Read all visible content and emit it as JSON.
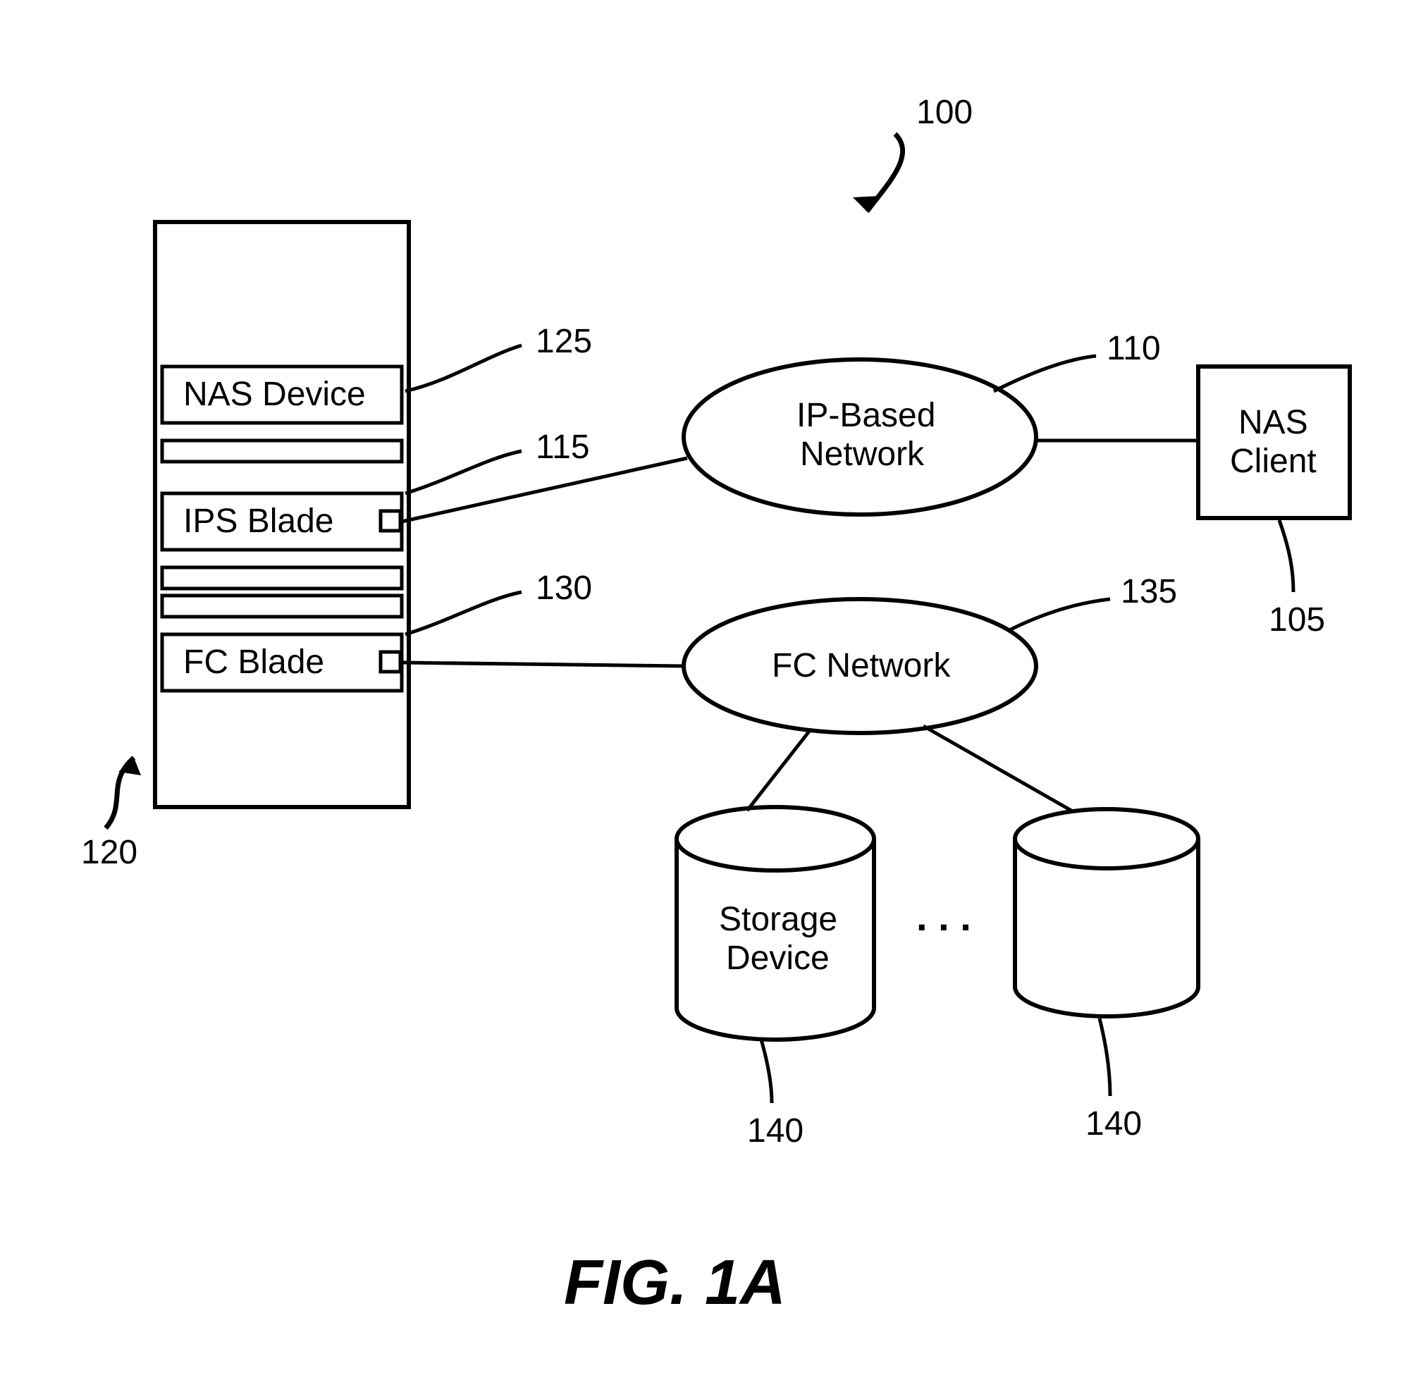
{
  "figure_label": "FIG. 1A",
  "refs": {
    "system": "100",
    "nas_client": "105",
    "ip_network": "110",
    "ips_blade": "115",
    "chassis": "120",
    "nas_device": "125",
    "fc_blade": "130",
    "fc_network": "135",
    "storage_left": "140",
    "storage_right": "140"
  },
  "labels": {
    "nas_device": "NAS Device",
    "ips_blade": "IPS Blade",
    "fc_blade": "FC Blade",
    "ip_network_l1": "IP-Based",
    "ip_network_l2": "Network",
    "fc_network": "FC Network",
    "nas_client_l1": "NAS",
    "nas_client_l2": "Client",
    "storage_l1": "Storage",
    "storage_l2": "Device",
    "ellipsis": ". . ."
  }
}
